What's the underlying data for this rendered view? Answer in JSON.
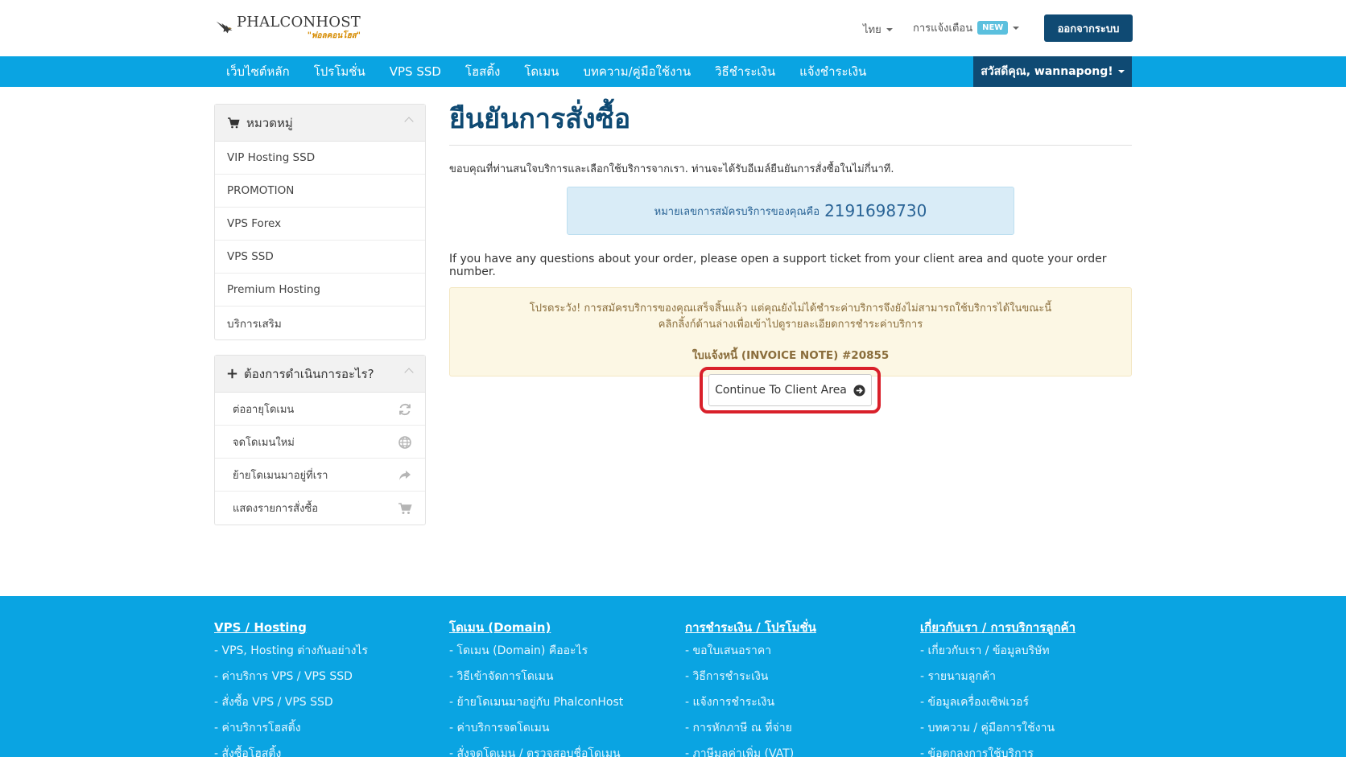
{
  "header": {
    "logo_name": "PHALCONHOST",
    "logo_tag": "\"พ่อลคอนโฮส\"",
    "language": "ไทย",
    "notifications": "การแจ้งเตือน",
    "new_badge": "NEW",
    "logout": "ออกจากระบบ"
  },
  "nav": {
    "items": [
      "เว็บไซต์หลัก",
      "โปรโมชั่น",
      "VPS SSD",
      "โฮสติ้ง",
      "โดเมน",
      "บทความ/คู่มือใช้งาน",
      "วิธีชำระเงิน",
      "แจ้งชำระเงิน"
    ],
    "user": "สวัสดีคุณ, wannapong!"
  },
  "sidebar": {
    "categories_title": "หมวดหมู่",
    "categories": [
      "VIP Hosting SSD",
      "PROMOTION",
      "VPS Forex",
      "VPS SSD",
      "Premium Hosting",
      "บริการเสริม"
    ],
    "actions_title": "ต้องการดำเนินการอะไร?",
    "actions": [
      "ต่ออายุโดเมน",
      "จดโดเมนใหม่",
      "ย้ายโดเมนมาอยู่ที่เรา",
      "แสดงรายการสั่งซื้อ"
    ]
  },
  "main": {
    "title": "ยืนยันการสั่งซื้อ",
    "thanks": "ขอบคุณที่ท่านสนใจบริการและเลือกใช้บริการจากเรา. ท่านจะได้รับอีเมล์ยืนยันการสั่งซื้อในไม่กี่นาที.",
    "order_label": "หมายเลขการสมัครบริการของคุณคือ",
    "order_number": "2191698730",
    "questions": "If you have any questions about your order, please open a support ticket from your client area and quote your order number.",
    "warn_line1": "โปรดระวัง! การสมัครบริการของคุณเสร็จสิ้นแล้ว แต่คุณยังไม่ได้ชำระค่าบริการจึงยังไม่สามารถใช้บริการได้ในขณะนี้",
    "warn_line2": "คลิกลิ้งก์ด้านล่างเพื่อเข้าไปดูรายละเอียดการชำระค่าบริการ",
    "invoice_note": "ใบแจ้งหนี้ (INVOICE NOTE) #20855",
    "cta": "Continue To Client Area"
  },
  "footer": {
    "columns": [
      {
        "title": "VPS / Hosting",
        "links": [
          "- VPS, Hosting ต่างกันอย่างไร",
          "- ค่าบริการ VPS / VPS SSD",
          "- สั่งซื้อ VPS / VPS SSD",
          "- ค่าบริการโฮสติ้ง",
          "- สั่งซื้อโฮสติ้ง"
        ]
      },
      {
        "title": "โดเมน (Domain)",
        "links": [
          "- โดเมน (Domain) คืออะไร",
          "- วิธีเข้าจัดการโดเมน",
          "- ย้ายโดเมนมาอยู่กับ PhalconHost",
          "- ค่าบริการจดโดเมน",
          "- สั่งจดโดเมน / ตรวจสอบชื่อโดเมน"
        ]
      },
      {
        "title": "การชำระเงิน / โปรโมชั่น",
        "links": [
          "- ขอใบเสนอราคา",
          "- วิธีการชำระเงิน",
          "- แจ้งการชำระเงิน",
          "- การหักภาษี ณ ที่จ่าย",
          "- ภาษีมูลค่าเพิ่ม (VAT)"
        ]
      },
      {
        "title": "เกี่ยวกับเรา / การบริการลูกค้า",
        "links": [
          "- เกี่ยวกับเรา / ข้อมูลบริษัท",
          "- รายนามลูกค้า",
          "- ข้อมูลเครื่องเซิฟเวอร์",
          "- บทความ / คู่มือการใช้งาน",
          "- ข้อตกลงการใช้บริการ"
        ]
      }
    ]
  },
  "colors": {
    "nav_blue": "#0aa4e2",
    "dark_blue": "#0f4a73",
    "highlight_red": "#d9202a"
  }
}
